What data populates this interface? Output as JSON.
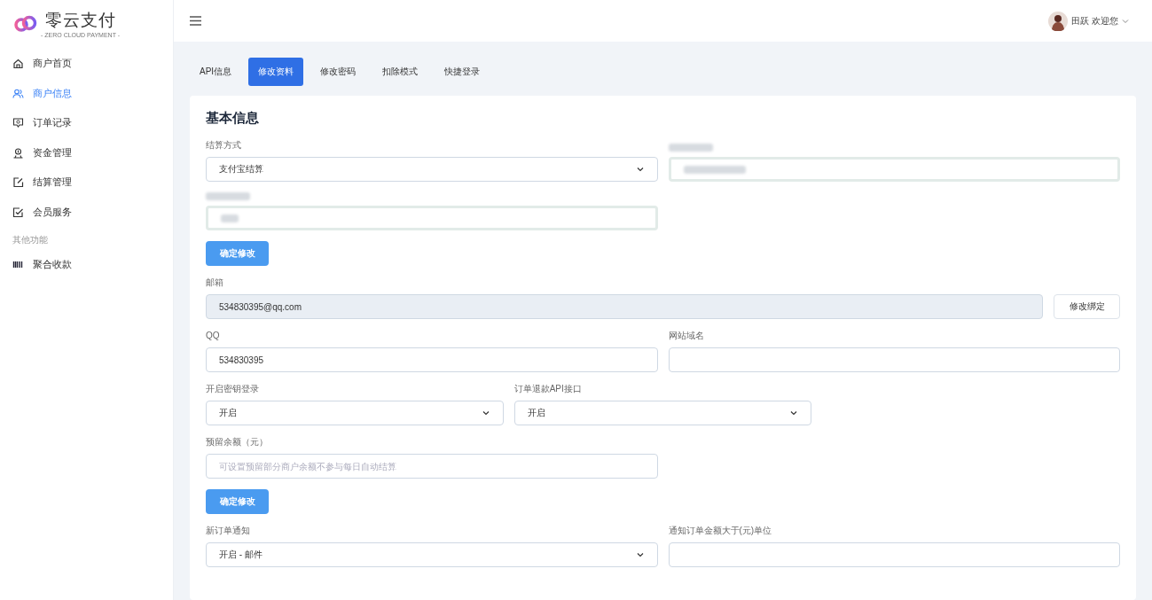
{
  "sidebar": {
    "logo": {
      "title": "零云支付",
      "subtitle": "- ZERO CLOUD PAYMENT -"
    },
    "items": [
      {
        "label": "商户首页",
        "selected": false
      },
      {
        "label": "商户信息",
        "selected": true
      },
      {
        "label": "订单记录",
        "selected": false
      },
      {
        "label": "资金管理",
        "selected": false
      },
      {
        "label": "结算管理",
        "selected": false
      },
      {
        "label": "会员服务",
        "selected": false
      }
    ],
    "section": "其他功能",
    "extra_items": [
      {
        "label": "聚合收款",
        "selected": false
      }
    ]
  },
  "header": {
    "user": "田跃 欢迎您"
  },
  "tabs": [
    {
      "label": "API信息",
      "selected": false
    },
    {
      "label": "修改资料",
      "selected": true
    },
    {
      "label": "修改密码",
      "selected": false
    },
    {
      "label": "扣除模式",
      "selected": false
    },
    {
      "label": "快捷登录",
      "selected": false
    }
  ],
  "card": {
    "title": "基本信息",
    "rows": [
      [
        {
          "kind": "select",
          "label": "结算方式",
          "value": "支付宝结算"
        },
        {
          "kind": "redacted"
        }
      ],
      [
        {
          "kind": "redacted"
        }
      ],
      [
        {
          "kind": "button",
          "label": "确定修改"
        }
      ],
      [
        {
          "kind": "input",
          "label": "邮箱",
          "value": "534830395@qq.com",
          "disabled": true
        },
        {
          "kind": "outline-button",
          "label": "修改绑定"
        }
      ],
      [
        {
          "kind": "input",
          "label": "QQ",
          "value": "534830395"
        },
        {
          "kind": "input",
          "label": "网站域名"
        }
      ],
      [
        {
          "kind": "select",
          "label": "开启密钥登录",
          "value": "开启"
        },
        {
          "kind": "select",
          "label": "订单退款API接口",
          "value": "开启"
        }
      ],
      [
        {
          "kind": "input",
          "label": "预留余额（元）",
          "placeholder": "可设置预留部分商户余额不参与每日自动结算"
        }
      ],
      [
        {
          "kind": "button",
          "label": "确定修改"
        }
      ],
      [
        {
          "kind": "select",
          "label": "新订单通知",
          "value": "开启 - 邮件"
        },
        {
          "kind": "input",
          "label": "通知订单金额大于(元)单位"
        }
      ]
    ]
  }
}
